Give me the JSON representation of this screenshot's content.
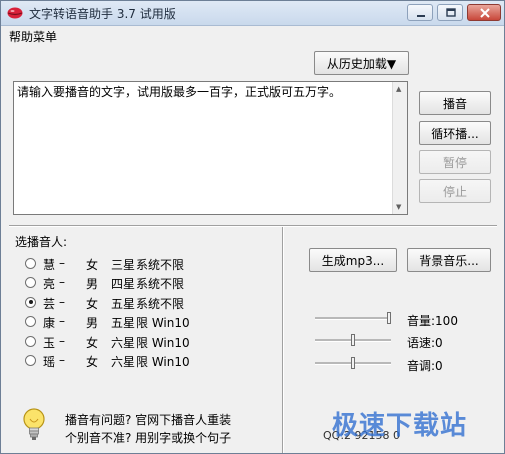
{
  "window": {
    "title": "文字转语音助手 3.7 试用版"
  },
  "menu": {
    "help": "帮助菜单"
  },
  "history_button": "从历史加载▼",
  "input": {
    "text": "请输入要播音的文字，试用版最多一百字，正式版可五万字。"
  },
  "controls": {
    "play": "播音",
    "loop_play": "循环播...",
    "pause": "暂停",
    "stop": "停止"
  },
  "voice_section": {
    "heading": "选播音人:",
    "selected_index": 2,
    "voices": [
      {
        "name": "慧",
        "dash": "–",
        "gender": "女",
        "stars": "三星",
        "limit": "系统不限"
      },
      {
        "name": "亮",
        "dash": "–",
        "gender": "男",
        "stars": "四星",
        "limit": "系统不限"
      },
      {
        "name": "芸",
        "dash": "–",
        "gender": "女",
        "stars": "五星",
        "limit": "系统不限"
      },
      {
        "name": "康",
        "dash": "–",
        "gender": "男",
        "stars": "五星",
        "limit": "限 Win10"
      },
      {
        "name": "玉",
        "dash": "–",
        "gender": "女",
        "stars": "六星",
        "limit": "限 Win10"
      },
      {
        "name": "瑶",
        "dash": "–",
        "gender": "女",
        "stars": "六星",
        "limit": "限 Win10"
      }
    ]
  },
  "output": {
    "generate_mp3": "生成mp3...",
    "background_music": "背景音乐..."
  },
  "sliders": {
    "volume": {
      "label": "音量:100",
      "value": 100,
      "min": 0,
      "max": 100
    },
    "rate": {
      "label": "语速:0",
      "value": 0,
      "min": -10,
      "max": 10
    },
    "pitch": {
      "label": "音调:0",
      "value": 0,
      "min": -10,
      "max": 10
    }
  },
  "help": {
    "line1": "播音有问题? 官网下播音人重装",
    "line2": "个别音不准? 用别字或换个句子"
  },
  "footer": {
    "qq": "QQ:2   92158   0",
    "watermark": "极速下载站"
  },
  "colors": {
    "window_bg": "#f0f0f0",
    "title_gradient_top": "#dfe9f5",
    "close_red": "#c8473a",
    "watermark_blue": "#2f6ed1"
  }
}
